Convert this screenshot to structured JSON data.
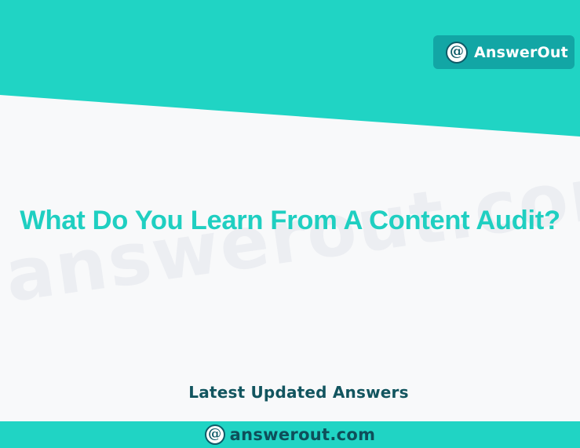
{
  "brand": {
    "name": "AnswerOut",
    "icon": "a-at-icon",
    "badge_color": "#12a6a5"
  },
  "main": {
    "title": "What Do You Learn From A Content Audit?",
    "subtitle": "Latest Updated Answers"
  },
  "watermark": {
    "text": "answerout.com"
  },
  "footer": {
    "domain": "answerout.com",
    "icon": "a-at-icon"
  },
  "colors": {
    "accent": "#20d4c4",
    "title": "#1fcfc1",
    "subtitle": "#12555f",
    "background": "#f8f9fa"
  }
}
